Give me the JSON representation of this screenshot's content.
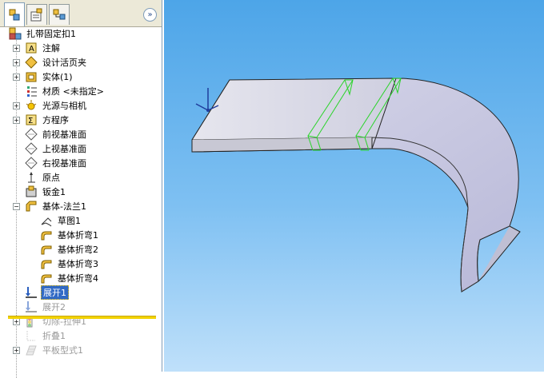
{
  "tabs": [
    {
      "icon": "feature-manager-icon",
      "active": true
    },
    {
      "icon": "property-manager-icon",
      "active": false
    },
    {
      "icon": "configuration-manager-icon",
      "active": false
    }
  ],
  "collapse_glyph": "»",
  "tree": {
    "root": "扎带固定扣1",
    "items": [
      {
        "label": "注解",
        "icon": "annotations-icon",
        "expander": "+"
      },
      {
        "label": "设计活页夹",
        "icon": "design-binder-icon",
        "expander": "+"
      },
      {
        "label": "实体(1)",
        "icon": "solid-bodies-icon",
        "expander": "+"
      },
      {
        "label": "材质 <未指定>",
        "icon": "material-icon",
        "expander": ""
      },
      {
        "label": "光源与相机",
        "icon": "lights-cameras-icon",
        "expander": "+"
      },
      {
        "label": "方程序",
        "icon": "equations-icon",
        "expander": "+"
      },
      {
        "label": "前视基准面",
        "icon": "plane-icon",
        "expander": ""
      },
      {
        "label": "上视基准面",
        "icon": "plane-icon",
        "expander": ""
      },
      {
        "label": "右视基准面",
        "icon": "plane-icon",
        "expander": ""
      },
      {
        "label": "原点",
        "icon": "origin-icon",
        "expander": ""
      },
      {
        "label": "钣金1",
        "icon": "sheet-metal-icon",
        "expander": ""
      },
      {
        "label": "基体-法兰1",
        "icon": "base-flange-icon",
        "expander": "−"
      },
      {
        "label": "草图1",
        "icon": "sketch-icon",
        "expander": ""
      },
      {
        "label": "基体折弯1",
        "icon": "bend-icon",
        "expander": ""
      },
      {
        "label": "基体折弯2",
        "icon": "bend-icon",
        "expander": ""
      },
      {
        "label": "基体折弯3",
        "icon": "bend-icon",
        "expander": ""
      },
      {
        "label": "基体折弯4",
        "icon": "bend-icon",
        "expander": ""
      },
      {
        "label": "展开1",
        "icon": "unfold-icon",
        "expander": "",
        "selected": true
      },
      {
        "label": "展开2",
        "icon": "unfold-icon",
        "expander": "",
        "suppressed": true
      },
      {
        "label": "切除-拉伸1",
        "icon": "cut-extrude-icon",
        "expander": "+",
        "suppressed": true
      },
      {
        "label": "折叠1",
        "icon": "fold-icon",
        "expander": "",
        "suppressed": true
      },
      {
        "label": "平板型式1",
        "icon": "flat-pattern-icon",
        "expander": "+",
        "suppressed": true
      }
    ]
  },
  "viewport": {
    "model": "sheet-metal-part",
    "triad": "coordinate-triad-icon"
  }
}
